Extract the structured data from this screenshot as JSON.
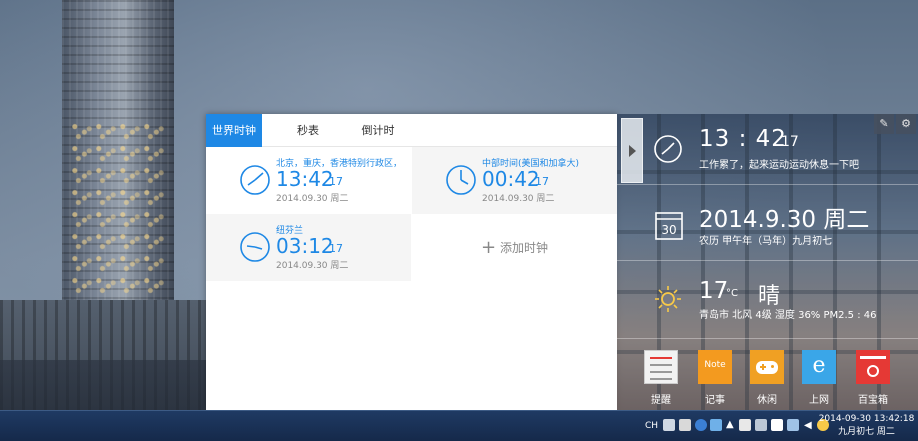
{
  "clock_window": {
    "tabs": [
      {
        "label": "世界时钟",
        "active": true
      },
      {
        "label": "秒表",
        "active": false
      },
      {
        "label": "倒计时",
        "active": false
      }
    ],
    "clocks": [
      {
        "city": "北京，重庆，香港特别行政区，",
        "time": "13:42",
        "seconds": "17",
        "date": "2014.09.30 周二"
      },
      {
        "city": "中部时间(美国和加拿大)",
        "time": "00:42",
        "seconds": "17",
        "date": "2014.09.30 周二"
      },
      {
        "city": "纽芬兰",
        "time": "03:12",
        "seconds": "17",
        "date": "2014.09.30 周二"
      }
    ],
    "add_clock_label": "添加时钟"
  },
  "widget_panel": {
    "time": "13 : 42",
    "seconds": "17",
    "tip": "工作累了，起来运动运动休息一下吧",
    "calendar_day": "30",
    "date": "2014.9.30 周二",
    "lunar": "农历 甲午年（马年）九月初七",
    "temperature": "17",
    "temp_unit": "°C",
    "weather": "晴",
    "weather_info": "青岛市  北风 4级 湿度 36%    PM2.5 : 46",
    "apps": [
      {
        "label": "提醒",
        "icon": "reminder-icon",
        "color": "#f2f2f2"
      },
      {
        "label": "记事",
        "icon": "note-icon",
        "color": "#f39a1f"
      },
      {
        "label": "休闲",
        "icon": "gamepad-icon",
        "color": "#f0a023"
      },
      {
        "label": "上网",
        "icon": "ie-icon",
        "color": "#3aa6e8"
      },
      {
        "label": "百宝箱",
        "icon": "toolbox-icon",
        "color": "#e53935"
      }
    ],
    "note_tile_text": "Note"
  },
  "taskbar": {
    "lang": "CH",
    "clock_line1": "2014-09-30  13:42:18",
    "clock_line2": "九月初七 周二"
  }
}
